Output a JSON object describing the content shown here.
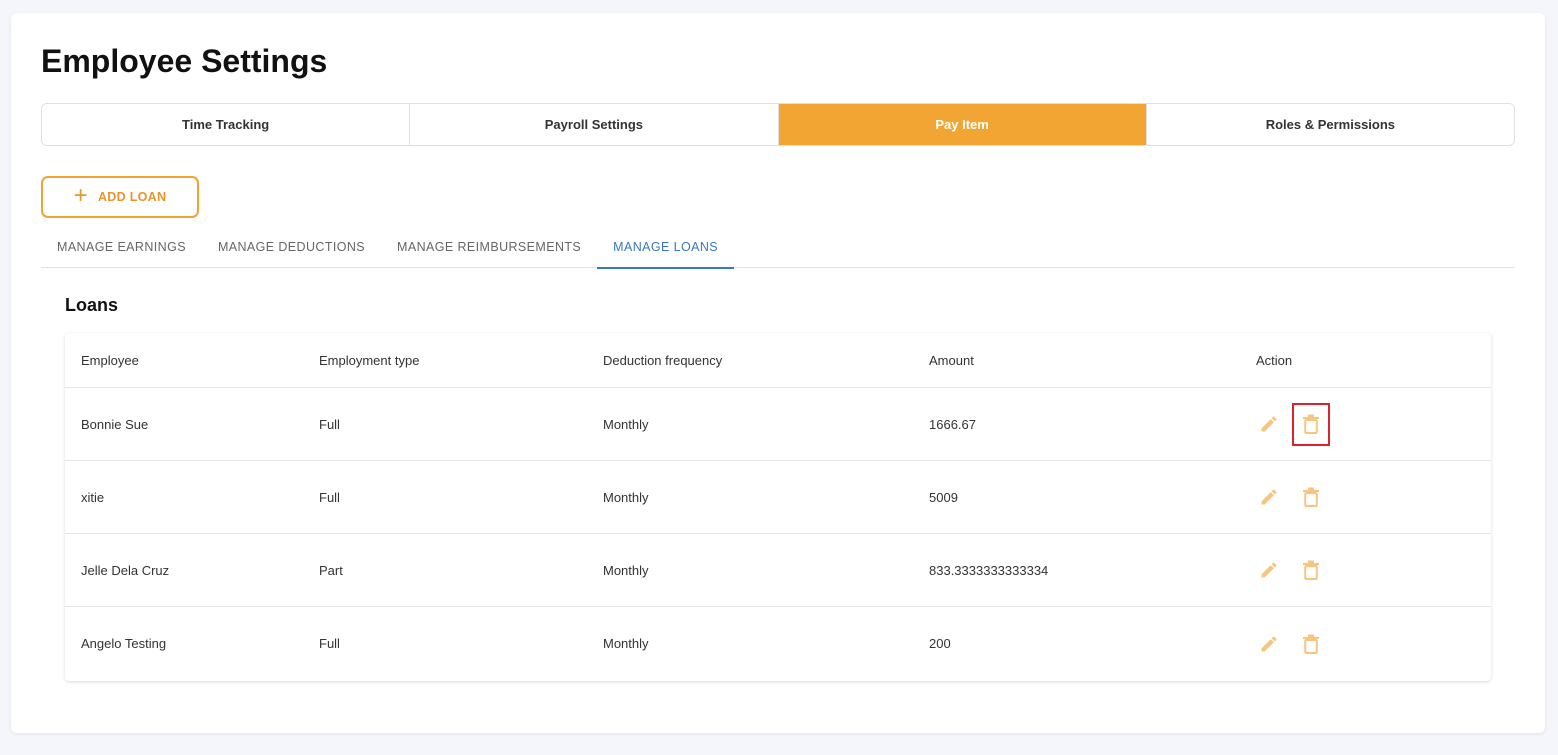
{
  "page": {
    "title": "Employee Settings"
  },
  "top_tabs": [
    {
      "label": "Time Tracking",
      "active": false
    },
    {
      "label": "Payroll Settings",
      "active": false
    },
    {
      "label": "Pay Item",
      "active": true
    },
    {
      "label": "Roles & Permissions",
      "active": false
    }
  ],
  "add_button": {
    "label": "ADD LOAN",
    "icon": "plus-icon"
  },
  "sub_tabs": [
    {
      "label": "MANAGE EARNINGS",
      "active": false
    },
    {
      "label": "MANAGE DEDUCTIONS",
      "active": false
    },
    {
      "label": "MANAGE REIMBURSEMENTS",
      "active": false
    },
    {
      "label": "MANAGE LOANS",
      "active": true
    }
  ],
  "section": {
    "title": "Loans"
  },
  "table": {
    "headers": [
      "Employee",
      "Employment type",
      "Deduction frequency",
      "Amount",
      "Action"
    ],
    "rows": [
      {
        "employee": "Bonnie Sue",
        "type": "Full",
        "frequency": "Monthly",
        "amount": "1666.67"
      },
      {
        "employee": "xitie",
        "type": "Full",
        "frequency": "Monthly",
        "amount": "5009"
      },
      {
        "employee": "Jelle Dela Cruz",
        "type": "Part",
        "frequency": "Monthly",
        "amount": "833.3333333333334"
      },
      {
        "employee": "Angelo Testing",
        "type": "Full",
        "frequency": "Monthly",
        "amount": "200"
      }
    ]
  },
  "colors": {
    "accent": "#f3a533",
    "action_icon": "#f6c681",
    "active_subtab": "#3a78c2",
    "highlight": "#d9232e"
  },
  "icons": {
    "edit": "pencil-icon",
    "delete": "trash-icon"
  }
}
